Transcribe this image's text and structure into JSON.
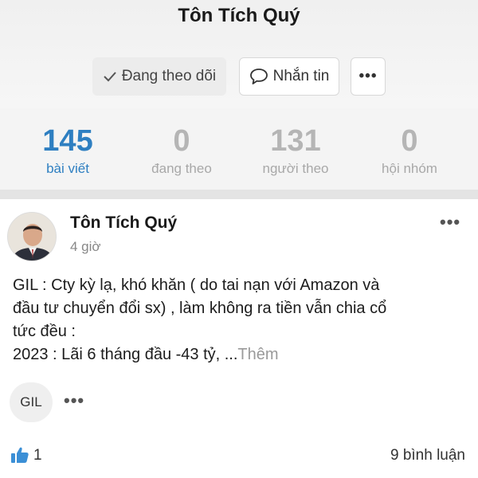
{
  "profile": {
    "name": "Tôn Tích Quý"
  },
  "actions": {
    "following_label": "Đang theo dõi",
    "message_label": "Nhắn tin",
    "more_label": "•••"
  },
  "stats": [
    {
      "value": "145",
      "label": "bài viết",
      "active": true
    },
    {
      "value": "0",
      "label": "đang theo",
      "active": false
    },
    {
      "value": "131",
      "label": "người theo",
      "active": false
    },
    {
      "value": "0",
      "label": "hội nhóm",
      "active": false
    }
  ],
  "post": {
    "author": "Tôn Tích Quý",
    "time": "4 giờ",
    "menu_label": "•••",
    "lines": [
      "GIL : Cty kỳ lạ, khó khăn ( do tai nạn với Amazon và",
      "đầu tư  chuyển đổi sx) , làm không ra tiền vẫn chia cổ",
      "tức đều :"
    ],
    "last_line": "2023 : Lãi 6 tháng đầu -43 tỷ, ...",
    "more_link": "Thêm",
    "tag": "GIL",
    "tag_more": "•••",
    "likes": "1",
    "comments": "9 bình luận"
  },
  "colors": {
    "accent": "#2e7fc1",
    "stat_inactive": "#b5b5b5",
    "like_icon": "#3b8fd6"
  },
  "icons": {
    "following": "check-icon",
    "message": "chat-bubble-icon",
    "like": "thumbs-up-icon"
  }
}
